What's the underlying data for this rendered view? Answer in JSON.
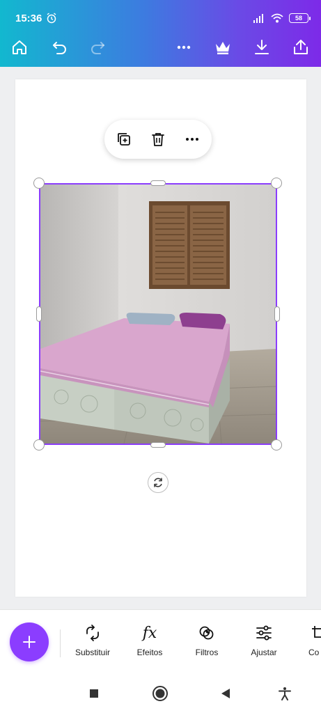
{
  "status_bar": {
    "time": "15:36",
    "battery_level": "58",
    "icons": [
      "alarm-icon",
      "signal-icon",
      "wifi-icon",
      "battery-icon"
    ]
  },
  "toolbar": {
    "icons": [
      "home-icon",
      "undo-icon",
      "redo-icon",
      "more-icon",
      "crown-icon",
      "download-icon",
      "share-icon"
    ]
  },
  "float_menu": {
    "icons": [
      "duplicate-icon",
      "delete-icon",
      "more-icon"
    ]
  },
  "tools": [
    {
      "label": "Substituir",
      "icon": "replace-icon"
    },
    {
      "label": "Efeitos",
      "icon": "fx-icon"
    },
    {
      "label": "Filtros",
      "icon": "filters-icon"
    },
    {
      "label": "Ajustar",
      "icon": "adjust-icon"
    },
    {
      "label": "Co",
      "icon": "crop-icon"
    }
  ],
  "fx_glyph": "fx",
  "colors": {
    "accent": "#8b3dff",
    "gradient_start": "#12b8cf",
    "gradient_end": "#7d2ae8"
  },
  "nav_bar": {
    "icons": [
      "recents-icon",
      "home-circle-icon",
      "back-icon",
      "accessibility-icon"
    ]
  }
}
